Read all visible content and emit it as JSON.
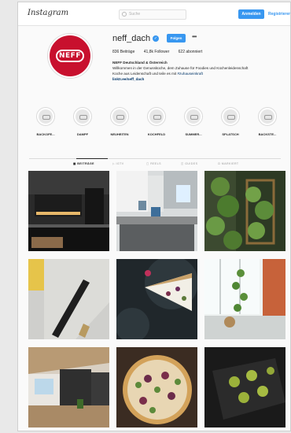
{
  "header": {
    "logo": "Instagram",
    "search_placeholder": "Suche",
    "login_label": "Anmelden",
    "register_label": "Registrieren"
  },
  "profile": {
    "username": "neff_dach",
    "verified_badge": "✓",
    "follow_label": "Folgen",
    "more_label": "•••",
    "avatar_logo": "NEFF",
    "stats": {
      "posts": "836 Beiträge",
      "followers": "41,8k Follower",
      "following": "622 abonniert"
    },
    "bio": {
      "name": "NEFF Deutschland & Österreich",
      "line1": "Willkommen in der Genussküche, dem Zuhause für Foodies und Küchenleidenschaft",
      "line2_prefix": "Koche aus Leidenschaft und teile es mit",
      "line2_tag": "#zuhauseinkraft",
      "link": "linktr.ee/neff_dach"
    }
  },
  "highlights": [
    {
      "label": "BACKOFE..."
    },
    {
      "label": "DAMPF"
    },
    {
      "label": "NEUHEITEN"
    },
    {
      "label": "KOCHFELD"
    },
    {
      "label": "SUMMER..."
    },
    {
      "label": "SPLATSCH"
    },
    {
      "label": "BACKSTE..."
    }
  ],
  "tabs": [
    {
      "label": "▦ BEITRÄGE",
      "active": true
    },
    {
      "label": "▷ IGTV",
      "active": false
    },
    {
      "label": "▢ REELS",
      "active": false
    },
    {
      "label": "◫ GUIDES",
      "active": false
    },
    {
      "label": "⊡ MARKIERT",
      "active": false
    }
  ],
  "posts": [
    {
      "subject": "dark-kitchen"
    },
    {
      "subject": "white-kitchen"
    },
    {
      "subject": "vertical-garden"
    },
    {
      "subject": "marble-knife"
    },
    {
      "subject": "cheesecake"
    },
    {
      "subject": "herb-window"
    },
    {
      "subject": "living-kitchen"
    },
    {
      "subject": "pizza"
    },
    {
      "subject": "herb-tray"
    }
  ],
  "colors": {
    "brand_red": "#c8102e",
    "accent_blue": "#3897f0",
    "background": "#fafafa"
  }
}
